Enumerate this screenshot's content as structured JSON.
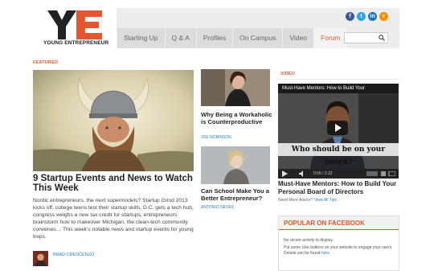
{
  "logo": {
    "letters": "YE",
    "text": "YOUNG ENTREPRENEUR"
  },
  "nav": [
    {
      "label": "Starting Up"
    },
    {
      "label": "Q & A"
    },
    {
      "label": "Profiles"
    },
    {
      "label": "On Campus"
    },
    {
      "label": "Video"
    },
    {
      "label": "Forum"
    }
  ],
  "social": [
    "facebook-icon",
    "twitter-icon",
    "linkedin-icon",
    "rss-icon"
  ],
  "colors": {
    "accent": "#e4572e",
    "link": "#2a80b9",
    "nav_bg": "#dcdcdc"
  },
  "search": {
    "placeholder": ""
  },
  "featured": {
    "label": "FEATURED",
    "title": "9 Startup Events and News to Watch This Week",
    "body": "Nordic entrepreneurs, the next supermodels? Startup Grind 2013 kicks off, college teens test their startup skills, D.C. gets a tech hub, congress weighs a new tax credit for startups, entrepreneurs brainstorm how to makeover Michigan, the clean-tech community convenes… This week's notable news and startup events for young treps.",
    "author": "BRAD CRESCENZO"
  },
  "side_articles": [
    {
      "title": "Why Being a Workaholic is Counterproductive",
      "author": "JOE ROBINSON"
    },
    {
      "title": "Can School Make You a Better Entrepreneur?",
      "author": "ANTONIO NEVES"
    }
  ],
  "video": {
    "label": "VIDEO",
    "player_title": "Must-Have Mentors: How to Build Your",
    "caption": "Who should be on your board?",
    "time": "0:00 / 2:22",
    "heading": "Must-Have Mentors: How to Build Your Personal Board of Directors",
    "need_more": "Need More Advice?",
    "view_all": "View All Tips"
  },
  "facebook": {
    "title": "POPULAR ON FACEBOOK",
    "line1": "No recent activity to display.",
    "line2": "Put some Like buttons on your website to engage your users. Details can be found",
    "link": "here."
  }
}
